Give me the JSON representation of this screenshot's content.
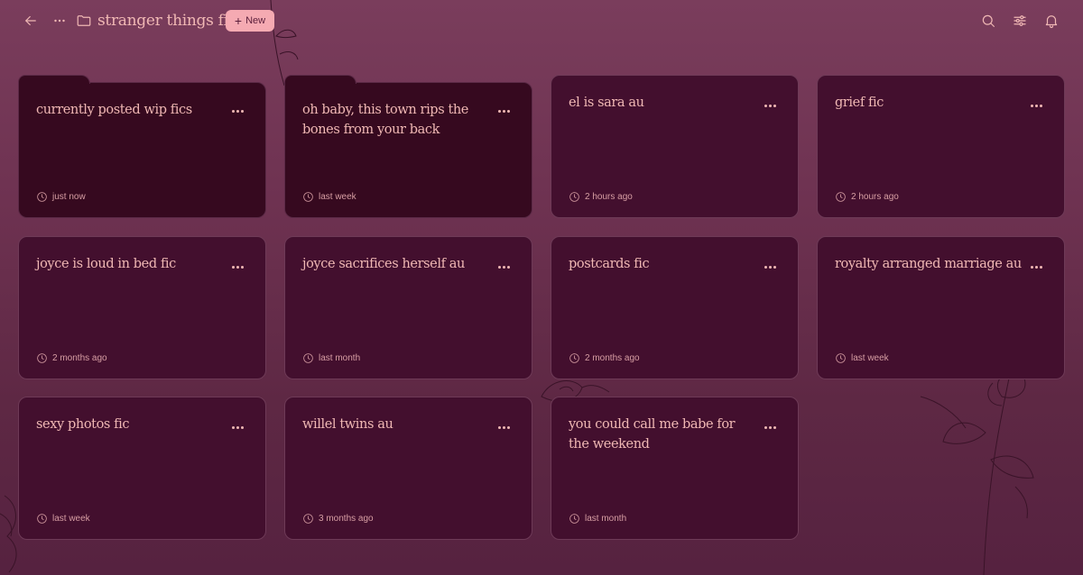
{
  "topbar": {
    "back_icon": "arrow-left-icon",
    "more_icon": "ellipsis-icon",
    "folder_icon": "folder-icon",
    "title": "stranger things fic",
    "new_label": "New",
    "search_icon": "search-icon",
    "filter_icon": "sliders-icon",
    "notifications_icon": "bell-icon"
  },
  "cards": [
    {
      "title": "currently posted wip fics",
      "time": "just now",
      "kind": "folder"
    },
    {
      "title": "oh baby, this town rips the bones from your back",
      "time": "last week",
      "kind": "folder"
    },
    {
      "title": "el is sara au",
      "time": "2 hours ago",
      "kind": "doc"
    },
    {
      "title": "grief fic",
      "time": "2 hours ago",
      "kind": "doc"
    },
    {
      "title": "joyce is loud in bed fic",
      "time": "2 months ago",
      "kind": "doc"
    },
    {
      "title": "joyce sacrifices herself au",
      "time": "last month",
      "kind": "doc"
    },
    {
      "title": "postcards fic",
      "time": "2 months ago",
      "kind": "doc"
    },
    {
      "title": "royalty arranged marriage au",
      "time": "last week",
      "kind": "doc"
    },
    {
      "title": "sexy photos fic",
      "time": "last week",
      "kind": "doc"
    },
    {
      "title": "willel twins au",
      "time": "3 months ago",
      "kind": "doc"
    },
    {
      "title": "you could call me babe for the weekend",
      "time": "last month",
      "kind": "doc"
    }
  ],
  "colors": {
    "accent": "#f5aab2",
    "text": "#f0b8b4",
    "card": "#430f2e",
    "folder_card": "#36091f",
    "background": "#6e3251"
  }
}
